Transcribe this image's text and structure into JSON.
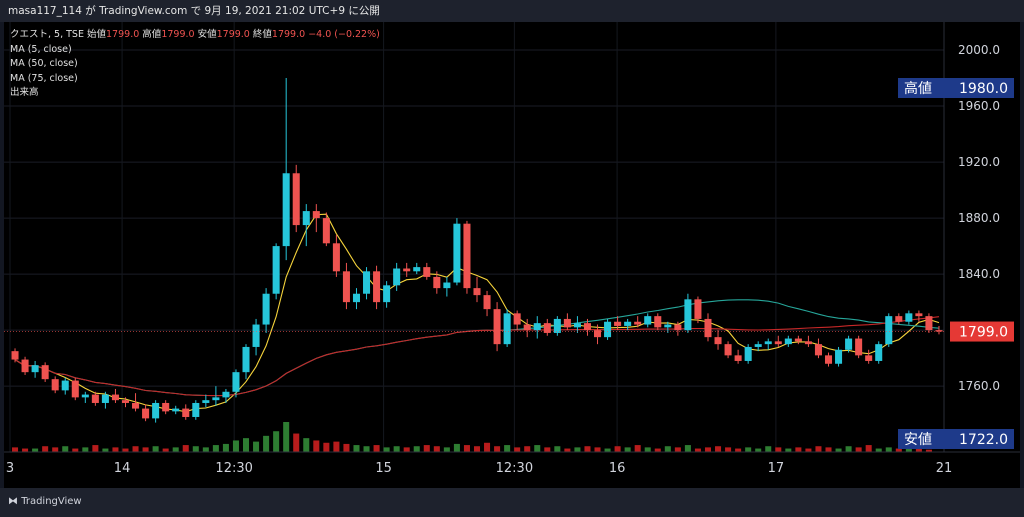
{
  "header": {
    "text": "masa117_114 が TradingView.com で 9月 19, 2021 21:02 UTC+9 に公開"
  },
  "legend": {
    "symbol": "クエスト, 5, TSE",
    "ohlc": [
      {
        "label": "始値",
        "value": "1799.0"
      },
      {
        "label": "高値",
        "value": "1799.0"
      },
      {
        "label": "安値",
        "value": "1799.0"
      },
      {
        "label": "終値",
        "value": "1799.0"
      }
    ],
    "change": "−4.0 (−0.22%)",
    "indicators": [
      "MA (5, close)",
      "MA (50, close)",
      "MA (75, close)",
      "出来高"
    ]
  },
  "footer": {
    "brand": "TradingView"
  },
  "colors": {
    "up": "#26c6da",
    "down": "#ef5350",
    "ma5": "#f5d33b",
    "ma50": "#26a69a",
    "ma75": "#c62828",
    "volUp": "#2e7d32",
    "volDown": "#b71c1c",
    "badge": "#1e3a8a"
  },
  "chart_data": {
    "type": "candlestick",
    "y_ticks": [
      "2000.0",
      "1960.0",
      "1920.0",
      "1880.0",
      "1840.0",
      "1799.0",
      "1760.0"
    ],
    "y_tick_values": [
      2000,
      1960,
      1920,
      1880,
      1840,
      1800,
      1760
    ],
    "ylim": [
      1713,
      2020
    ],
    "x_tick_labels": [
      "3",
      "14",
      "12:30",
      "15",
      "12:30",
      "16",
      "17",
      "21"
    ],
    "badges": {
      "high": {
        "label": "高値",
        "value": "1980.0"
      },
      "last": {
        "value": "1799.0"
      },
      "low": {
        "label": "安値",
        "value": "1722.0"
      }
    },
    "ohlc": [
      [
        1785,
        1787,
        1777,
        1779
      ],
      [
        1779,
        1781,
        1768,
        1770
      ],
      [
        1770,
        1778,
        1766,
        1775
      ],
      [
        1775,
        1777,
        1763,
        1765
      ],
      [
        1765,
        1767,
        1755,
        1757
      ],
      [
        1757,
        1766,
        1754,
        1764
      ],
      [
        1764,
        1766,
        1750,
        1752
      ],
      [
        1752,
        1756,
        1748,
        1754
      ],
      [
        1754,
        1756,
        1746,
        1748
      ],
      [
        1748,
        1756,
        1744,
        1754
      ],
      [
        1754,
        1758,
        1748,
        1750
      ],
      [
        1750,
        1752,
        1745,
        1748
      ],
      [
        1748,
        1755,
        1742,
        1744
      ],
      [
        1744,
        1747,
        1735,
        1737
      ],
      [
        1737,
        1750,
        1734,
        1748
      ],
      [
        1748,
        1750,
        1740,
        1742
      ],
      [
        1742,
        1746,
        1740,
        1744
      ],
      [
        1744,
        1747,
        1736,
        1738
      ],
      [
        1738,
        1750,
        1736,
        1748
      ],
      [
        1748,
        1754,
        1745,
        1750
      ],
      [
        1750,
        1760,
        1746,
        1752
      ],
      [
        1752,
        1758,
        1748,
        1756
      ],
      [
        1756,
        1772,
        1752,
        1770
      ],
      [
        1770,
        1790,
        1765,
        1788
      ],
      [
        1788,
        1808,
        1782,
        1804
      ],
      [
        1804,
        1830,
        1798,
        1826
      ],
      [
        1826,
        1862,
        1822,
        1860
      ],
      [
        1860,
        1980,
        1850,
        1912
      ],
      [
        1912,
        1918,
        1870,
        1875
      ],
      [
        1875,
        1890,
        1860,
        1885
      ],
      [
        1885,
        1890,
        1870,
        1880
      ],
      [
        1880,
        1884,
        1860,
        1862
      ],
      [
        1862,
        1868,
        1838,
        1842
      ],
      [
        1842,
        1848,
        1815,
        1820
      ],
      [
        1820,
        1830,
        1815,
        1826
      ],
      [
        1826,
        1845,
        1822,
        1842
      ],
      [
        1842,
        1846,
        1815,
        1820
      ],
      [
        1820,
        1835,
        1816,
        1832
      ],
      [
        1832,
        1848,
        1828,
        1844
      ],
      [
        1844,
        1848,
        1838,
        1842
      ],
      [
        1842,
        1848,
        1840,
        1845
      ],
      [
        1845,
        1848,
        1836,
        1838
      ],
      [
        1838,
        1842,
        1826,
        1830
      ],
      [
        1830,
        1838,
        1824,
        1834
      ],
      [
        1834,
        1880,
        1832,
        1876
      ],
      [
        1876,
        1878,
        1826,
        1830
      ],
      [
        1830,
        1838,
        1820,
        1825
      ],
      [
        1825,
        1828,
        1810,
        1815
      ],
      [
        1815,
        1820,
        1785,
        1790
      ],
      [
        1790,
        1815,
        1788,
        1812
      ],
      [
        1812,
        1814,
        1800,
        1804
      ],
      [
        1804,
        1808,
        1795,
        1800
      ],
      [
        1800,
        1810,
        1794,
        1805
      ],
      [
        1805,
        1808,
        1796,
        1798
      ],
      [
        1798,
        1810,
        1796,
        1808
      ],
      [
        1808,
        1812,
        1800,
        1802
      ],
      [
        1802,
        1810,
        1798,
        1805
      ],
      [
        1805,
        1808,
        1796,
        1800
      ],
      [
        1800,
        1804,
        1790,
        1795
      ],
      [
        1795,
        1808,
        1793,
        1806
      ],
      [
        1806,
        1810,
        1800,
        1803
      ],
      [
        1803,
        1808,
        1800,
        1806
      ],
      [
        1806,
        1810,
        1802,
        1804
      ],
      [
        1804,
        1812,
        1802,
        1810
      ],
      [
        1810,
        1812,
        1800,
        1802
      ],
      [
        1802,
        1806,
        1798,
        1804
      ],
      [
        1804,
        1806,
        1796,
        1800
      ],
      [
        1800,
        1826,
        1798,
        1822
      ],
      [
        1822,
        1824,
        1805,
        1808
      ],
      [
        1808,
        1812,
        1792,
        1795
      ],
      [
        1795,
        1800,
        1786,
        1790
      ],
      [
        1790,
        1792,
        1780,
        1782
      ],
      [
        1782,
        1786,
        1776,
        1778
      ],
      [
        1778,
        1790,
        1776,
        1788
      ],
      [
        1788,
        1792,
        1785,
        1790
      ],
      [
        1790,
        1794,
        1786,
        1792
      ],
      [
        1792,
        1796,
        1788,
        1790
      ],
      [
        1790,
        1796,
        1788,
        1794
      ],
      [
        1794,
        1796,
        1790,
        1792
      ],
      [
        1792,
        1796,
        1788,
        1790
      ],
      [
        1790,
        1794,
        1780,
        1782
      ],
      [
        1782,
        1784,
        1774,
        1776
      ],
      [
        1776,
        1788,
        1774,
        1786
      ],
      [
        1786,
        1796,
        1784,
        1794
      ],
      [
        1794,
        1796,
        1780,
        1782
      ],
      [
        1782,
        1786,
        1776,
        1778
      ],
      [
        1778,
        1792,
        1776,
        1790
      ],
      [
        1790,
        1812,
        1788,
        1810
      ],
      [
        1810,
        1812,
        1804,
        1806
      ],
      [
        1806,
        1814,
        1804,
        1812
      ],
      [
        1812,
        1814,
        1806,
        1810
      ],
      [
        1810,
        1812,
        1798,
        1800
      ],
      [
        1800,
        1803,
        1797,
        1799
      ]
    ],
    "volume": [
      4,
      3,
      3,
      5,
      4,
      5,
      3,
      4,
      6,
      3,
      4,
      3,
      5,
      4,
      5,
      3,
      4,
      6,
      5,
      4,
      6,
      7,
      10,
      12,
      9,
      14,
      18,
      26,
      16,
      12,
      10,
      8,
      9,
      7,
      6,
      5,
      6,
      4,
      5,
      4,
      5,
      6,
      5,
      4,
      7,
      6,
      5,
      8,
      5,
      6,
      4,
      5,
      6,
      4,
      5,
      3,
      4,
      5,
      4,
      3,
      5,
      4,
      6,
      4,
      3,
      5,
      4,
      6,
      3,
      4,
      5,
      4,
      3,
      4,
      3,
      5,
      4,
      3,
      4,
      3,
      5,
      4,
      3,
      5,
      4,
      6,
      3,
      4,
      3,
      4,
      3,
      2
    ]
  }
}
